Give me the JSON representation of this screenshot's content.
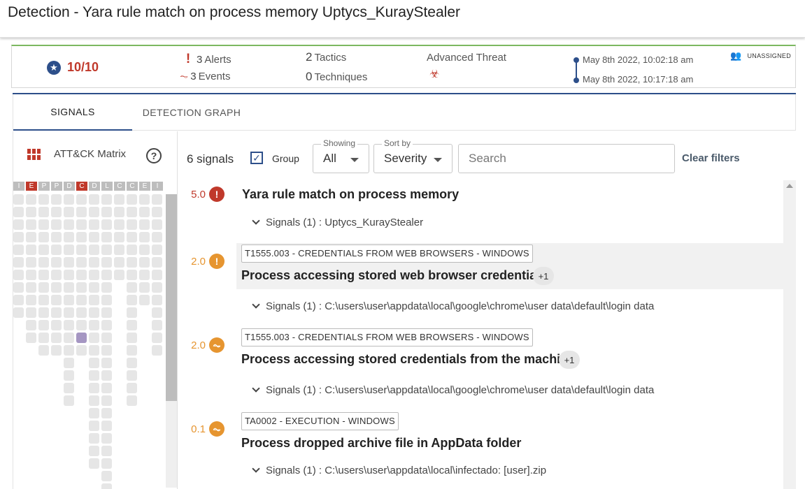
{
  "title": "Detection - Yara rule match on process memory Uptycs_KurayStealer",
  "summary": {
    "score": "10/10",
    "alerts_count": "3",
    "alerts_label": "Alerts",
    "events_count": "3",
    "events_label": "Events",
    "tactics_count": "2",
    "tactics_label": "Tactics",
    "techniques_count": "0",
    "techniques_label": "Techniques",
    "threat_label": "Advanced Threat",
    "time_start": "May 8th 2022, 10:02:18 am",
    "time_end": "May 8th 2022, 10:17:18 am",
    "assignee": "UNASSIGNED"
  },
  "tabs": [
    "SIGNALS",
    "DETECTION GRAPH"
  ],
  "matrix": {
    "title": "ATT&CK Matrix",
    "help": "?",
    "tactics": [
      {
        "letter": "I",
        "hit": false
      },
      {
        "letter": "E",
        "hit": true
      },
      {
        "letter": "P",
        "hit": false
      },
      {
        "letter": "P",
        "hit": false
      },
      {
        "letter": "D",
        "hit": false
      },
      {
        "letter": "C",
        "hit": true
      },
      {
        "letter": "D",
        "hit": false
      },
      {
        "letter": "L",
        "hit": false
      },
      {
        "letter": "C",
        "hit": false
      },
      {
        "letter": "C",
        "hit": false
      },
      {
        "letter": "E",
        "hit": false
      },
      {
        "letter": "I",
        "hit": false
      }
    ],
    "column_heights": [
      10,
      12,
      13,
      13,
      17,
      13,
      22,
      24,
      7,
      17,
      9,
      13
    ],
    "hit_cell": {
      "column": 5,
      "row": 11
    }
  },
  "filters": {
    "count_label": "6 signals",
    "group_label": "Group",
    "group_checked": true,
    "showing_label": "Showing",
    "showing_value": "All",
    "sort_label": "Sort by",
    "sort_value": "Severity",
    "search_placeholder": "Search",
    "clear_label": "Clear filters"
  },
  "signals": [
    {
      "score": "5.0",
      "severity": "critical",
      "badge": "!",
      "tag": "",
      "title": "Yara rule match on process memory",
      "plus": "",
      "detail": "Signals (1) : Uptycs_KurayStealer"
    },
    {
      "score": "2.0",
      "severity": "medium",
      "badge": "!",
      "tag": "T1555.003 - CREDENTIALS FROM WEB BROWSERS - WINDOWS",
      "title": "Process accessing stored web browser credentials",
      "plus": "+1",
      "detail": "Signals (1) : C:\\users\\user\\appdata\\local\\google\\chrome\\user data\\default\\login data"
    },
    {
      "score": "2.0",
      "severity": "medium",
      "badge": "pulse",
      "tag": "T1555.003 - CREDENTIALS FROM WEB BROWSERS - WINDOWS",
      "title": "Process accessing stored credentials from the machine",
      "plus": "+1",
      "detail": "Signals (1) : C:\\users\\user\\appdata\\local\\google\\chrome\\user data\\default\\login data"
    },
    {
      "score": "0.1",
      "severity": "low",
      "badge": "pulse",
      "tag": "TA0002 - EXECUTION - WINDOWS",
      "title": "Process dropped archive file in AppData folder",
      "plus": "",
      "detail": "Signals (1) : C:\\users\\user\\appdata\\local\\infectado: [user].zip"
    }
  ],
  "colors": {
    "critical": "#c0392b",
    "medium": "#e69530",
    "low": "#e69530",
    "accent": "#2d4f8a",
    "header_border": "#7cb860",
    "matrix_hit": "#a596c2"
  },
  "icons": [
    "star-icon",
    "alert-icon",
    "pulse-icon",
    "biohazard-icon",
    "people-icon",
    "grid-icon",
    "help-icon",
    "chevron-down-icon"
  ]
}
